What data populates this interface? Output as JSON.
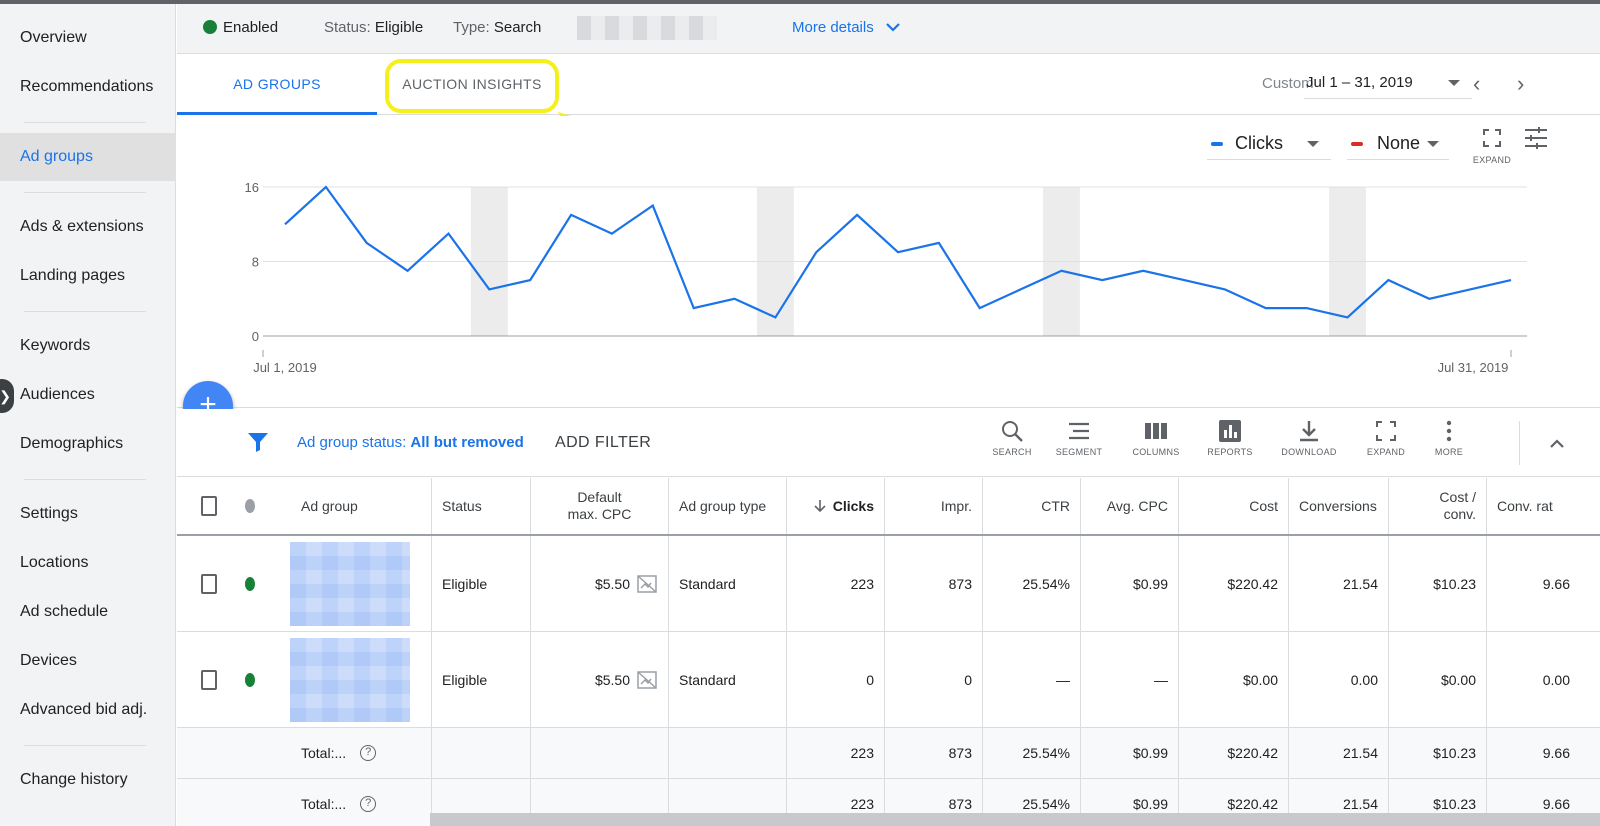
{
  "sidebar": {
    "items": [
      {
        "label": "Overview"
      },
      {
        "label": "Recommendations"
      },
      {
        "label": "Ad groups"
      },
      {
        "label": "Ads & extensions"
      },
      {
        "label": "Landing pages"
      },
      {
        "label": "Keywords"
      },
      {
        "label": "Audiences"
      },
      {
        "label": "Demographics"
      },
      {
        "label": "Settings"
      },
      {
        "label": "Locations"
      },
      {
        "label": "Ad schedule"
      },
      {
        "label": "Devices"
      },
      {
        "label": "Advanced bid adj."
      },
      {
        "label": "Change history"
      }
    ],
    "active": "Ad groups",
    "toggle_icon": "chevron-right-icon"
  },
  "status": {
    "enabled": "Enabled",
    "status_label": "Status:",
    "status_value": "Eligible",
    "type_label": "Type:",
    "type_value": "Search",
    "more_details": "More details"
  },
  "tabs": {
    "ad_groups": "AD GROUPS",
    "auction_insights": "AUCTION INSIGHTS",
    "active": "AD GROUPS"
  },
  "daterange": {
    "preset": "Custom",
    "range": "Jul 1 – 31, 2019"
  },
  "chart_controls": {
    "metric1": "Clicks",
    "metric1_color": "#1a73e8",
    "metric2": "None",
    "metric2_color": "#d93025",
    "expand_label": "EXPAND"
  },
  "chart_data": {
    "type": "line",
    "title": "",
    "xlabel": "",
    "ylabel": "",
    "x_start_label": "Jul 1, 2019",
    "x_end_label": "Jul 31, 2019",
    "yticks": [
      "0",
      "8",
      "16"
    ],
    "ylim": [
      0,
      16
    ],
    "weekend_bands": [
      [
        "Jul 6",
        "Jul 7"
      ],
      [
        "Jul 13",
        "Jul 14"
      ],
      [
        "Jul 20",
        "Jul 21"
      ],
      [
        "Jul 27",
        "Jul 28"
      ]
    ],
    "series": [
      {
        "name": "Clicks",
        "color": "#1a73e8",
        "values": [
          12,
          16,
          10,
          7,
          11,
          5,
          6,
          13,
          11,
          14,
          3,
          4,
          2,
          9,
          13,
          9,
          10,
          3,
          5,
          7,
          6,
          7,
          6,
          5,
          3,
          3,
          2,
          6,
          4,
          5,
          6
        ]
      }
    ],
    "grid": true
  },
  "filter": {
    "label": "Ad group status:",
    "value": "All but removed",
    "add_filter": "ADD FILTER"
  },
  "toolbar": {
    "search": "SEARCH",
    "segment": "SEGMENT",
    "columns": "COLUMNS",
    "reports": "REPORTS",
    "download": "DOWNLOAD",
    "expand": "EXPAND",
    "more": "MORE"
  },
  "table": {
    "headers": {
      "ad_group": "Ad group",
      "status": "Status",
      "default_cpc_1": "Default",
      "default_cpc_2": "max. CPC",
      "type": "Ad group type",
      "clicks": "Clicks",
      "impr": "Impr.",
      "ctr": "CTR",
      "avg_cpc": "Avg. CPC",
      "cost": "Cost",
      "conversions": "Conversions",
      "cost_conv_1": "Cost /",
      "cost_conv_2": "conv.",
      "conv_rate": "Conv. rat"
    },
    "rows": [
      {
        "status": "Eligible",
        "cpc": "$5.50",
        "type": "Standard",
        "clicks": "223",
        "impr": "873",
        "ctr": "25.54%",
        "avg_cpc": "$0.99",
        "cost": "$220.42",
        "conversions": "21.54",
        "cost_conv": "$10.23",
        "conv_rate": "9.66"
      },
      {
        "status": "Eligible",
        "cpc": "$5.50",
        "type": "Standard",
        "clicks": "0",
        "impr": "0",
        "ctr": "—",
        "avg_cpc": "—",
        "cost": "$0.00",
        "conversions": "0.00",
        "cost_conv": "$0.00",
        "conv_rate": "0.00"
      }
    ],
    "totals": [
      {
        "label": "Total:...",
        "clicks": "223",
        "impr": "873",
        "ctr": "25.54%",
        "avg_cpc": "$0.99",
        "cost": "$220.42",
        "conversions": "21.54",
        "cost_conv": "$10.23",
        "conv_rate": "9.66"
      },
      {
        "label": "Total:...",
        "clicks": "223",
        "impr": "873",
        "ctr": "25.54%",
        "avg_cpc": "$0.99",
        "cost": "$220.42",
        "conversions": "21.54",
        "cost_conv": "$10.23",
        "conv_rate": "9.66"
      }
    ]
  },
  "colors": {
    "accent": "#1a73e8",
    "enabled_green": "#188038",
    "highlight_yellow": "#f5ef1b"
  }
}
